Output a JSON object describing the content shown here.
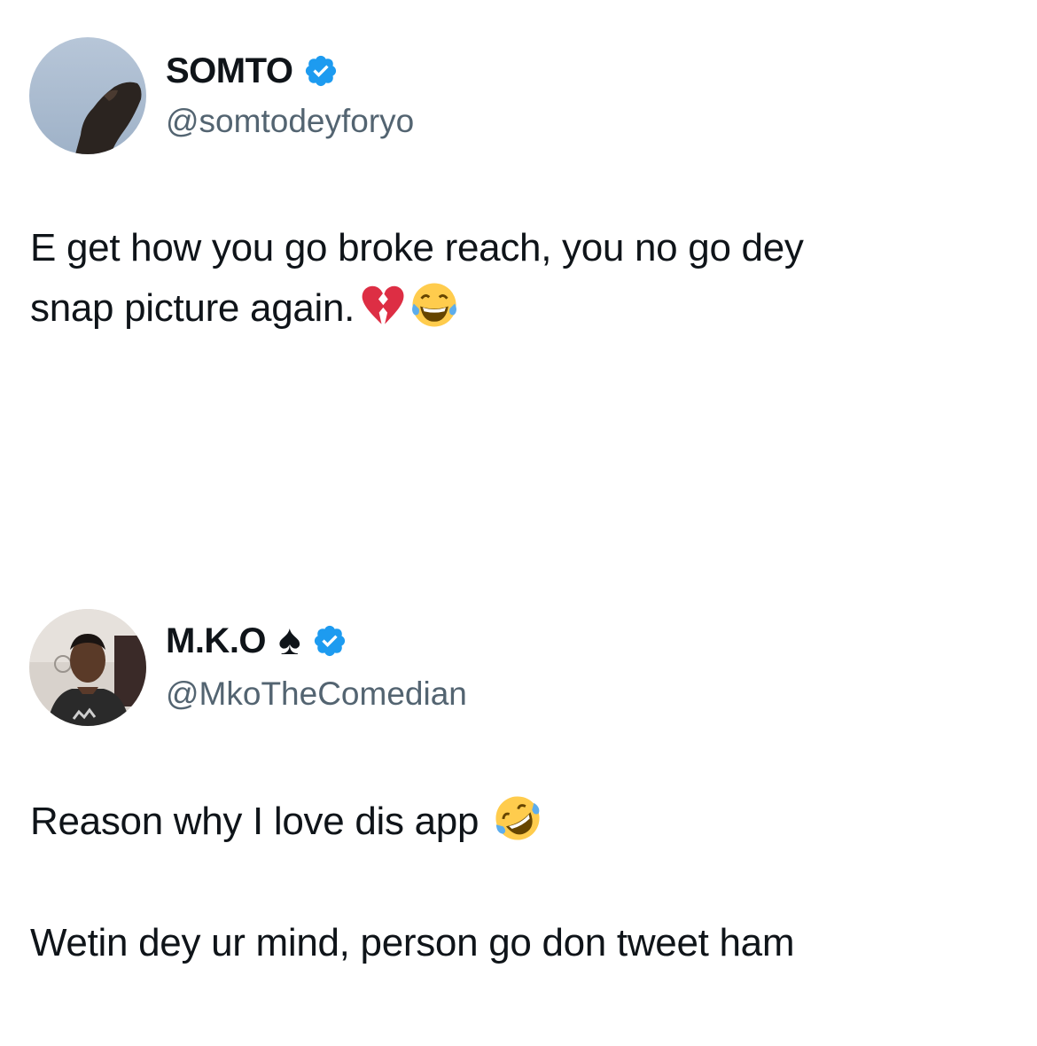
{
  "tweets": [
    {
      "display_name": "SOMTO",
      "handle": "@somtodeyforyo",
      "verified": true,
      "avatar_icon": "profile-photo-sky",
      "text_line_1": "E get how you go broke reach, you no go dey",
      "text_line_2": "snap picture again.",
      "emojis": [
        "broken-heart-icon",
        "tears-of-joy-icon"
      ]
    },
    {
      "display_name": "M.K.O",
      "name_suffix_glyph": "♠",
      "handle": "@MkoTheComedian",
      "verified": true,
      "avatar_icon": "profile-photo-man",
      "paragraph_1": "Reason why I love dis app",
      "paragraph_1_emoji": "rolling-on-floor-laughing-icon",
      "paragraph_2": "Wetin dey ur mind, person go don tweet ham"
    }
  ],
  "colors": {
    "verified_blue": "#1d9bf0",
    "text_primary": "#0f1419",
    "text_secondary": "#536471",
    "background": "#ffffff"
  }
}
